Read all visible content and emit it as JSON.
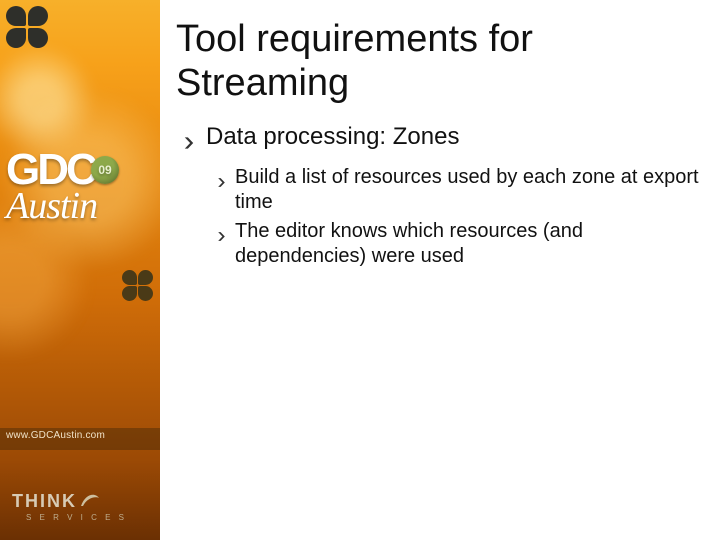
{
  "sidebar": {
    "logo_main": "GDC",
    "logo_badge": "09",
    "logo_sub": "Austin",
    "url": "www.GDCAustin.com",
    "sponsor_name": "THINK",
    "sponsor_sub": "S E R V I C E S"
  },
  "slide": {
    "title": "Tool requirements for Streaming",
    "bullets": [
      {
        "text": "Data processing: Zones",
        "children": [
          {
            "text": "Build a list of resources used by each zone at export time"
          },
          {
            "text": "The editor knows which resources (and dependencies) were used"
          }
        ]
      }
    ]
  }
}
